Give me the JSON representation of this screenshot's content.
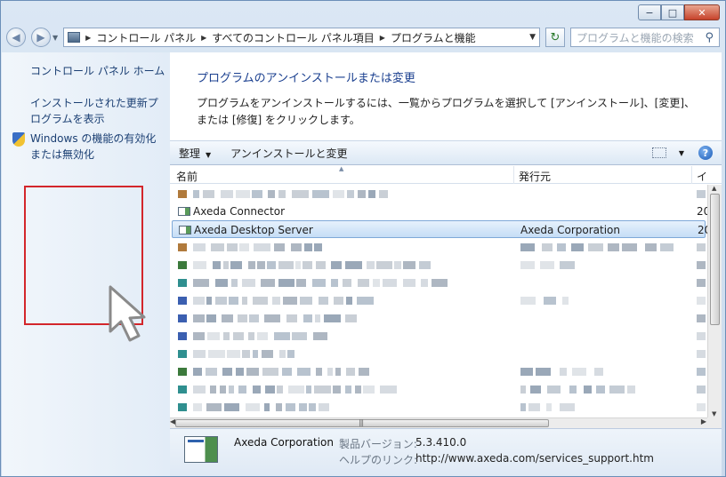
{
  "window": {
    "buttons": [
      "−",
      "□",
      "✕"
    ]
  },
  "navbar": {
    "breadcrumb": [
      "コントロール パネル",
      "すべてのコントロール パネル項目",
      "プログラムと機能"
    ],
    "search_placeholder": "プログラムと機能の検索"
  },
  "sidebar": {
    "items": [
      {
        "label": "コントロール パネル ホーム"
      },
      {
        "label": "インストールされた更新プログラムを表示"
      },
      {
        "label": "Windows の機能の有効化または無効化",
        "icon": "shield-icon"
      }
    ]
  },
  "main": {
    "heading": "プログラムのアンインストールまたは変更",
    "description": "プログラムをアンインストールするには、一覧からプログラムを選択して [アンインストール]、[変更]、または [修復] をクリックします。",
    "toolbar": {
      "organize": "整理",
      "uninstall_change": "アンインストールと変更"
    },
    "columns": {
      "name": "名前",
      "publisher": "発行元",
      "installed": "イ"
    },
    "rows": [
      {
        "name": "Axeda Connector",
        "publisher": "",
        "installed": "20"
      },
      {
        "name": "Axeda Desktop Server",
        "publisher": "Axeda Corporation",
        "installed": "20",
        "selected": true
      }
    ]
  },
  "details": {
    "company": "Axeda Corporation",
    "version_label": "製品バージョン:",
    "version": "5.3.410.0",
    "help_label": "ヘルプのリンク:",
    "help_link": "http://www.axeda.com/services_support.htm"
  },
  "colors": {
    "highlight_box": "#d3262b",
    "link": "#1b3f73",
    "heading": "#1a3f8f"
  }
}
